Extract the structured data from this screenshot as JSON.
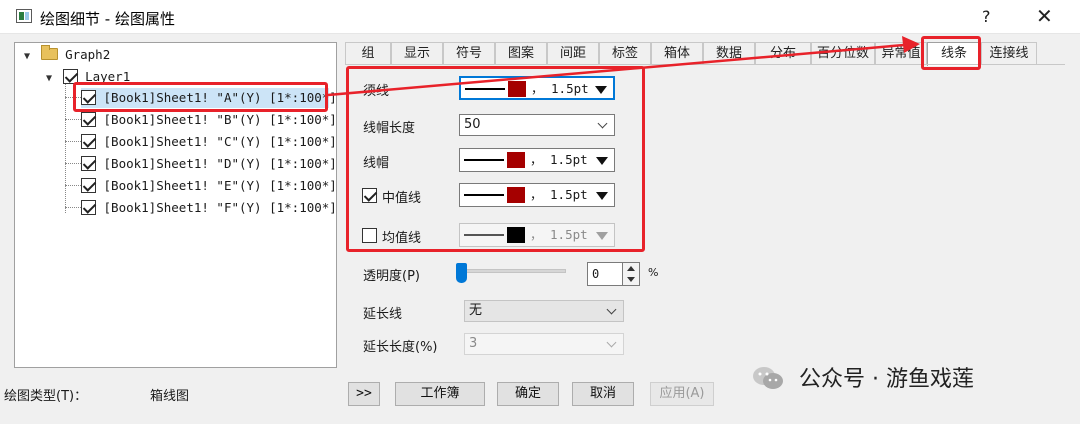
{
  "window": {
    "title": "绘图细节 - 绘图属性",
    "help": "?",
    "close": "✕"
  },
  "tree": {
    "root": "Graph2",
    "layer": "Layer1",
    "items": [
      "[Book1]Sheet1! \"A\"(Y)  [1*:100*]",
      "[Book1]Sheet1! \"B\"(Y)  [1*:100*]",
      "[Book1]Sheet1! \"C\"(Y)  [1*:100*]",
      "[Book1]Sheet1! \"D\"(Y)  [1*:100*]",
      "[Book1]Sheet1! \"E\"(Y)  [1*:100*]",
      "[Book1]Sheet1! \"F\"(Y)  [1*:100*]"
    ]
  },
  "tabs": [
    "组",
    "显示",
    "符号",
    "图案",
    "间距",
    "标签",
    "箱体",
    "数据",
    "分布",
    "百分位数",
    "异常值",
    "线条",
    "连接线"
  ],
  "active_tab": "线条",
  "lines": {
    "whisker_label": "须线",
    "whisker": {
      "width": "， 1.5pt",
      "color": "#a50000"
    },
    "cap_length_label": "线帽长度",
    "cap_length": "50",
    "cap_label": "线帽",
    "cap": {
      "width": "， 1.5pt",
      "color": "#a50000"
    },
    "median_label": "中值线",
    "median": {
      "width": "， 1.5pt",
      "color": "#a50000",
      "checked": true
    },
    "mean_label": "均值线",
    "mean": {
      "width": "， 1.5pt",
      "color": "#000000",
      "checked": false
    }
  },
  "transparency": {
    "label": "透明度(P)",
    "value": "0",
    "unit": "%"
  },
  "extension": {
    "label": "延长线",
    "value": "无",
    "length_label": "延长长度(%)",
    "length_value": "3"
  },
  "footer": {
    "plot_type_label": "绘图类型(T)：",
    "plot_type_value": "箱线图",
    "expand": ">>",
    "workbook": "工作簿",
    "ok": "确定",
    "cancel": "取消",
    "apply": "应用(A)"
  },
  "watermark": "公众号 · 游鱼戏莲",
  "annotation_color": "#e8222a"
}
